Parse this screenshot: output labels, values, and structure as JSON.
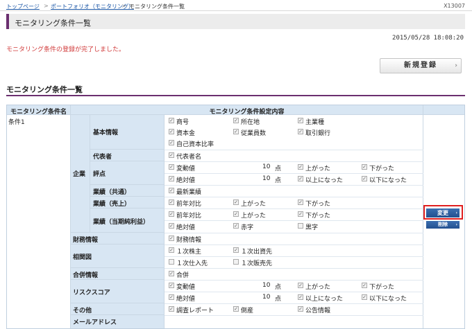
{
  "breadcrumb": {
    "items": [
      {
        "label": "トップページ"
      },
      {
        "label": "ポートフォリオ（モニタリング）"
      },
      {
        "label": "モニタリング条件一覧"
      }
    ],
    "separator": ">"
  },
  "screen_id": "X13007",
  "page_title": "モニタリング条件一覧",
  "datetime": "2015/05/28 18:08:20",
  "message": "モニタリング条件の登録が完了しました。",
  "new_button": {
    "label": "新規登録",
    "arrow": "›"
  },
  "section_title": "モニタリング条件一覧",
  "table": {
    "header_name": "モニタリング条件名",
    "header_content": "モニタリング条件設定内容",
    "condition_name": "条件1",
    "group_kigyo": "企業",
    "rows": {
      "kihon": {
        "label": "基本情報",
        "items": [
          "商号",
          "所在地",
          "主業種",
          "資本金",
          "従業員数",
          "取引銀行",
          "自己資本比率"
        ]
      },
      "daihyo": {
        "label": "代表者",
        "items": [
          "代表者名"
        ]
      },
      "hyoten": {
        "label": "評点",
        "r1": [
          "変動値",
          "10",
          "点",
          "上がった",
          "下がった"
        ],
        "r2": [
          "絶対値",
          "10",
          "点",
          "以上になった",
          "以下になった"
        ]
      },
      "kyotsu": {
        "label": "業績（共通）",
        "items": [
          "最新業績"
        ]
      },
      "uriage": {
        "label": "業績（売上）",
        "items": [
          "前年対比",
          "上がった",
          "下がった"
        ]
      },
      "junri": {
        "label": "業績（当期純利益）",
        "r1": [
          "前年対比",
          "上がった",
          "下がった"
        ],
        "r2": [
          "絶対値",
          "赤字",
          "黒字"
        ]
      },
      "zaimu": {
        "label": "財務情報",
        "items": [
          "財務情報"
        ]
      },
      "sokan": {
        "label": "相関図",
        "r1": [
          "１次株主",
          "１次出資先"
        ],
        "r2": [
          "１次仕入先",
          "１次販売先"
        ]
      },
      "gappei": {
        "label": "合併情報",
        "items": [
          "合併"
        ]
      },
      "risk": {
        "label": "リスクスコア",
        "r1": [
          "変動値",
          "10",
          "点",
          "上がった",
          "下がった"
        ],
        "r2": [
          "絶対値",
          "10",
          "点",
          "以上になった",
          "以下になった"
        ]
      },
      "other": {
        "label": "その他",
        "items": [
          "調査レポート",
          "倒産",
          "公告情報"
        ]
      },
      "mail": {
        "label": "メールアドレス"
      }
    }
  },
  "actions": {
    "change": "変更",
    "delete": "削除",
    "arrow": "›"
  },
  "check_mark": "✓",
  "colors": {
    "accent_purple": "#6b2f6f",
    "header_blue": "#d8e6f3",
    "link_blue": "#1a56a6",
    "message_red": "#d13b3b",
    "button_blue": "#22508f",
    "highlight_red": "#e01e1e"
  },
  "icons": {
    "checkbox": "checkbox-icon",
    "arrow": "chevron-right-icon"
  }
}
